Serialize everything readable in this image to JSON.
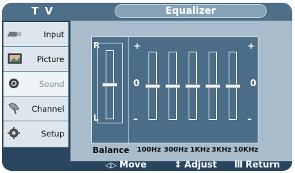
{
  "header": {
    "tv_label": "T V",
    "title": "Equalizer"
  },
  "sidebar": {
    "items": [
      {
        "label": "Input",
        "state": "normal"
      },
      {
        "label": "Picture",
        "state": "normal"
      },
      {
        "label": "Sound",
        "state": "active"
      },
      {
        "label": "Channel",
        "state": "normal"
      },
      {
        "label": "Setup",
        "state": "normal"
      }
    ]
  },
  "equalizer": {
    "balance_top_label": "R",
    "balance_bottom_label": "L",
    "balance_name": "Balance",
    "plus_label": "+",
    "minus_label": "–",
    "zero_label": "0",
    "bands": [
      {
        "label": "100Hz",
        "level": 0
      },
      {
        "label": "300Hz",
        "level": 0
      },
      {
        "label": "1KHz",
        "level": 0
      },
      {
        "label": "3KHz",
        "level": 0
      },
      {
        "label": "10KHz",
        "level": 0
      }
    ],
    "balance_level": 0
  },
  "footer": {
    "move_symbol": "◁▷",
    "move_label": "Move",
    "adjust_symbol": "⇕",
    "adjust_label": "Adjust",
    "return_symbol": "Ⅲ",
    "return_label": "Return"
  },
  "colors": {
    "frame": "#2a465f",
    "topbar": "#4d6f88",
    "panel": "#a9bccb",
    "eq_box": "#4b6d87",
    "text": "#ffffff"
  }
}
